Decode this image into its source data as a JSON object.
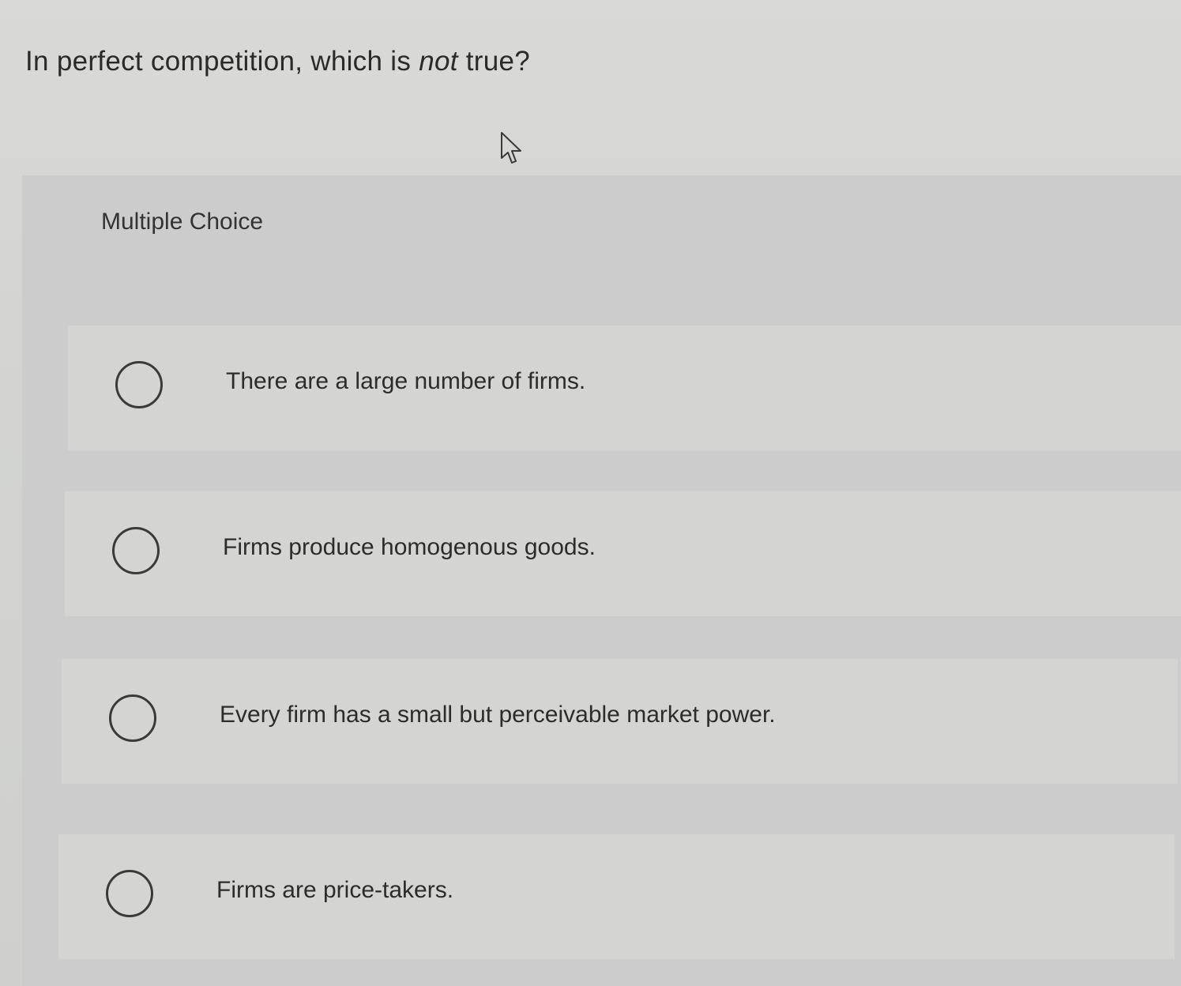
{
  "question": {
    "prefix": "In perfect competition, which is ",
    "emphasis": "not",
    "suffix": " true?"
  },
  "section_label": "Multiple Choice",
  "options": [
    {
      "label": "There are a large number of firms.",
      "selected": false
    },
    {
      "label": "Firms produce homogenous goods.",
      "selected": false
    },
    {
      "label": "Every firm has a small but perceivable market power.",
      "selected": false
    },
    {
      "label": "Firms are price-takers.",
      "selected": false
    }
  ],
  "icons": {
    "cursor": "mouse-pointer-icon",
    "radio": "radio-circle-icon"
  }
}
